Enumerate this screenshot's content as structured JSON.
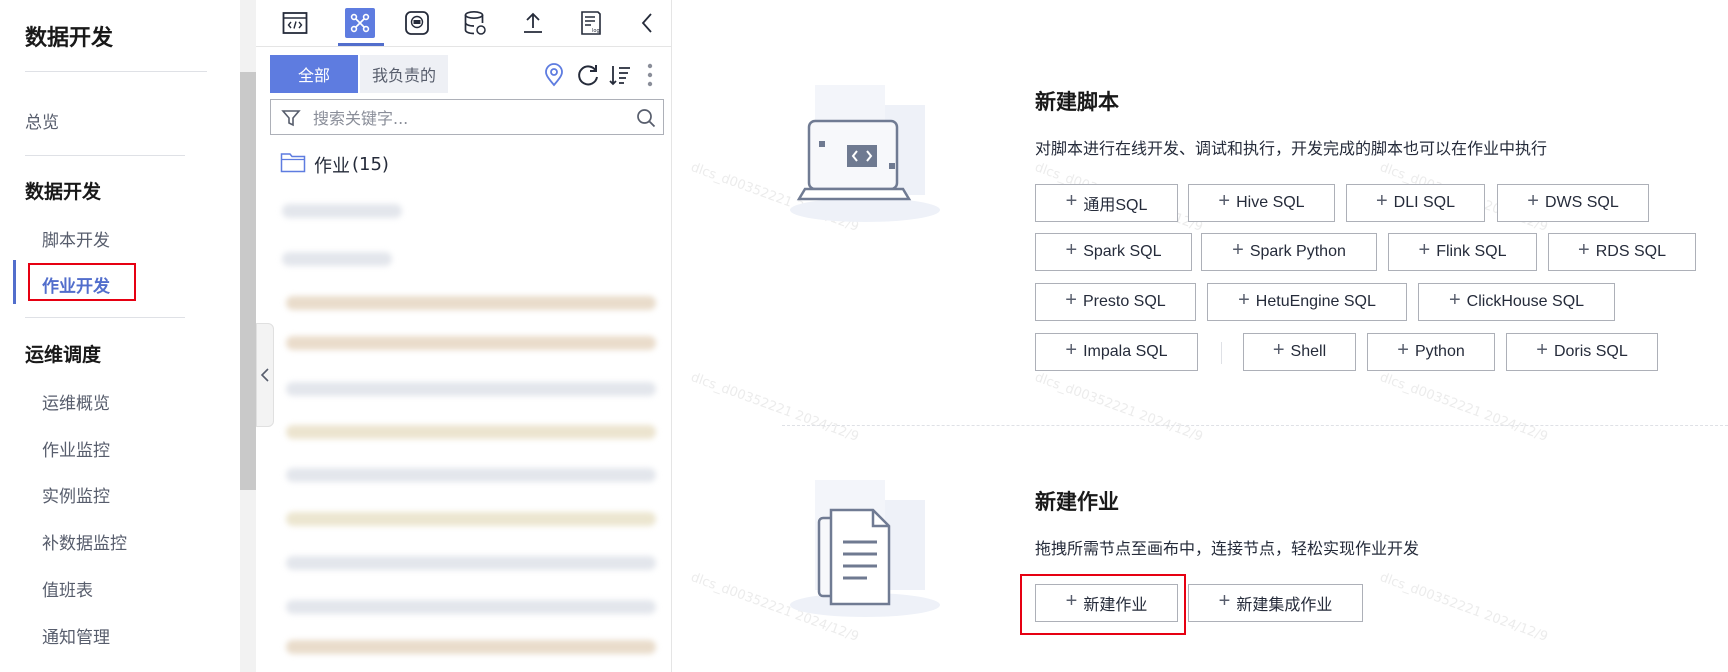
{
  "nav": {
    "title": "数据开发",
    "overview": "总览",
    "group_dev": "数据开发",
    "script_dev": "脚本开发",
    "job_dev": "作业开发",
    "group_ops": "运维调度",
    "ops_overview": "运维概览",
    "job_monitor": "作业监控",
    "instance_monitor": "实例监控",
    "backfill_monitor": "补数据监控",
    "duty_table": "值班表",
    "notify_mgmt": "通知管理"
  },
  "toolbar": {
    "icons": [
      "script-icon",
      "job-icon",
      "resource-icon",
      "database-icon",
      "upload-icon",
      "log-icon",
      "collapse-icon"
    ]
  },
  "tabs": {
    "all": "全部",
    "mine": "我负责的"
  },
  "search": {
    "placeholder": "搜索关键字..."
  },
  "tree": {
    "folder_label": "作业",
    "folder_count": "(15)"
  },
  "watermark": "dlcs_d00352221 2024/12/9",
  "script_section": {
    "title": "新建脚本",
    "desc": "对脚本进行在线开发、调试和执行，开发完成的脚本也可以在作业中执行",
    "buttons": [
      "通用SQL",
      "Hive SQL",
      "DLI SQL",
      "DWS SQL",
      "Spark SQL",
      "Spark Python",
      "Flink SQL",
      "RDS SQL",
      "Presto SQL",
      "HetuEngine SQL",
      "ClickHouse SQL",
      "Impala SQL",
      "Shell",
      "Python",
      "Doris SQL"
    ]
  },
  "job_section": {
    "title": "新建作业",
    "desc": "拖拽所需节点至画布中，连接节点，轻松实现作业开发",
    "new_job": "新建作业",
    "new_integration_job": "新建集成作业"
  },
  "colors": {
    "accent": "#5e7ce0",
    "highlight": "#e60012"
  }
}
